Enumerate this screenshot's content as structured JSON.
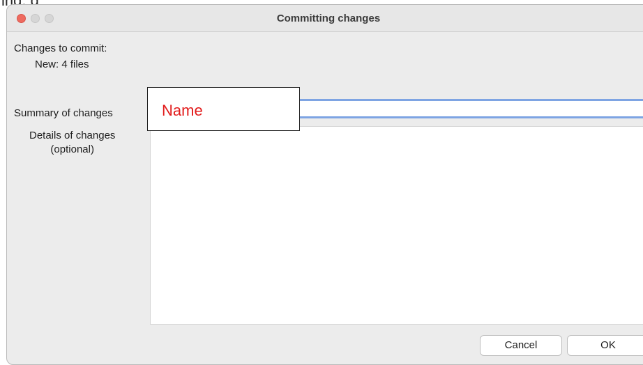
{
  "overlay": {
    "cropped_text": "ing, g"
  },
  "window": {
    "title": "Committing changes"
  },
  "changes": {
    "heading": "Changes to commit:",
    "new_count": "New: 4 files"
  },
  "form": {
    "summary_label": "Summary of changes",
    "summary_value": "",
    "details_label_line1": "Details of changes",
    "details_label_line2": "(optional)",
    "details_value": ""
  },
  "annotation": {
    "text": "Name",
    "color": "#e21b1b"
  },
  "buttons": {
    "cancel": "Cancel",
    "ok": "OK"
  },
  "colors": {
    "focus_ring": "#7ea4e3",
    "close_light": "#ee6a5f"
  }
}
